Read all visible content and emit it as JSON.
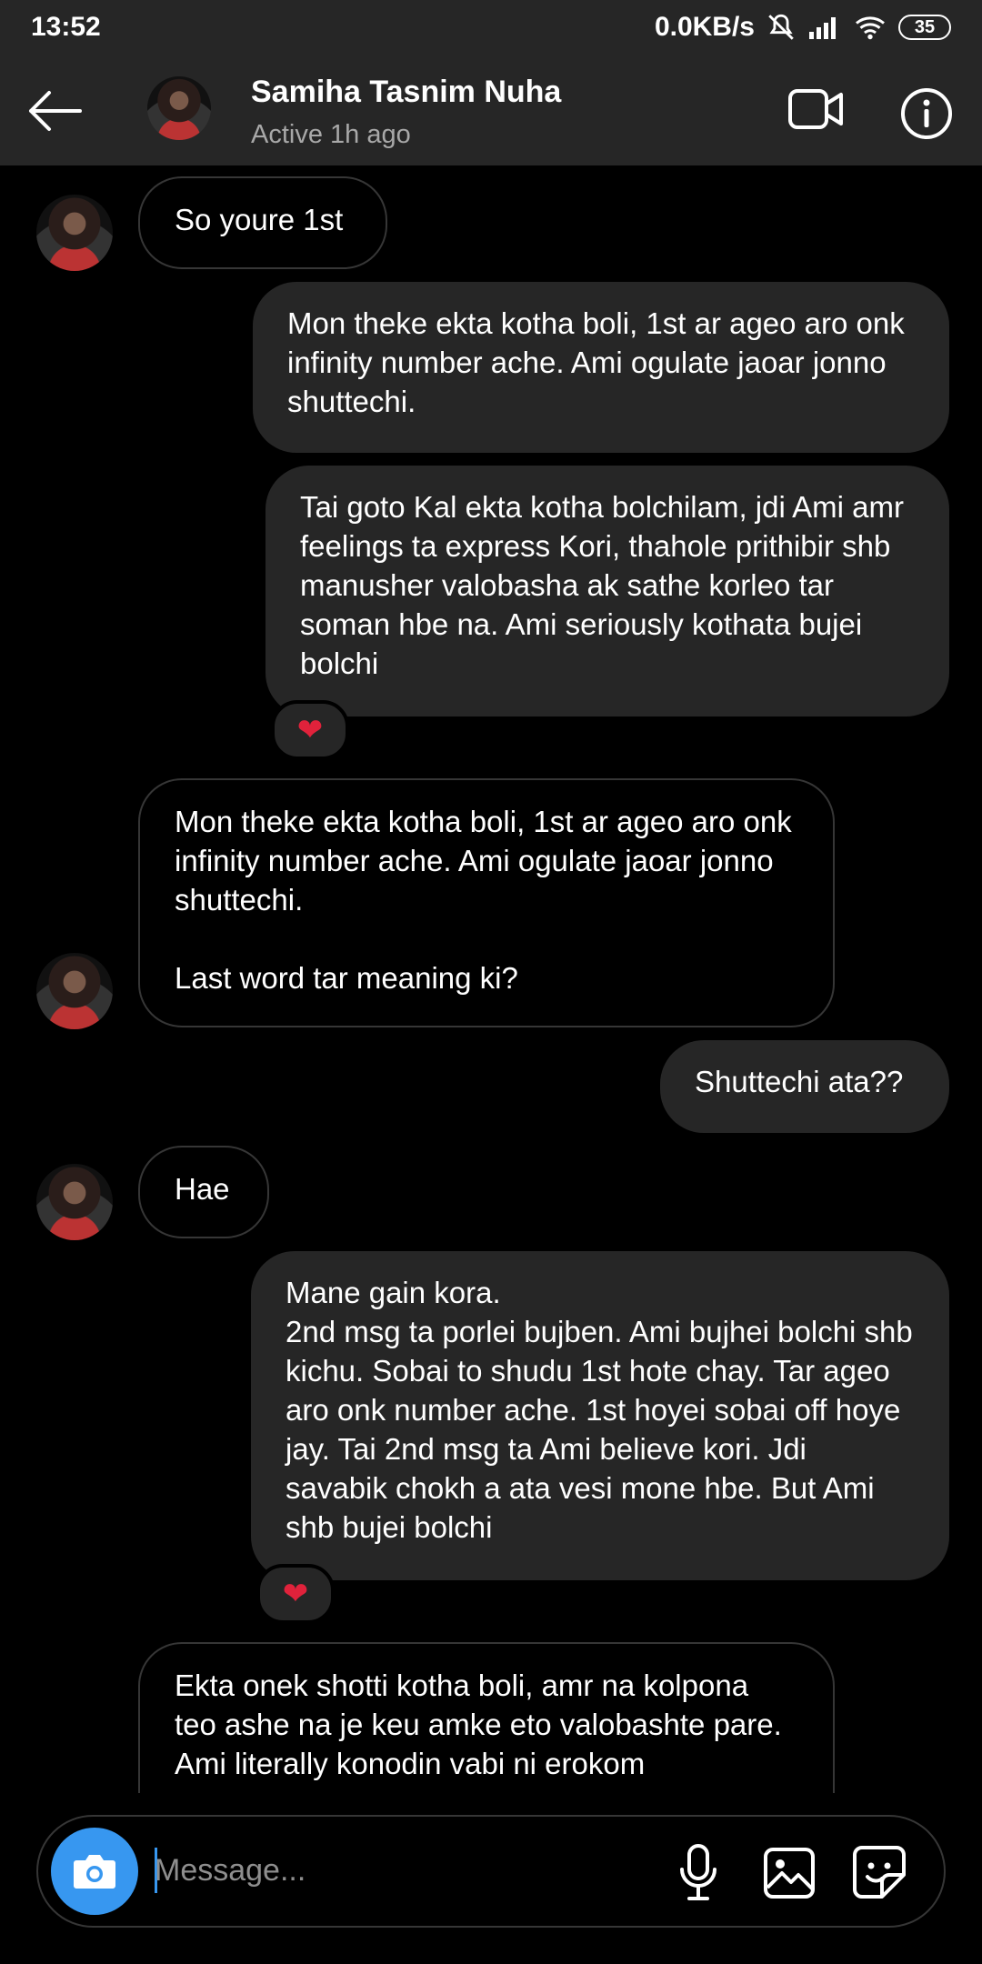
{
  "statusbar": {
    "time": "13:52",
    "network_speed": "0.0KB/s",
    "battery": "35"
  },
  "header": {
    "name": "Samiha Tasnim Nuha",
    "status": "Active 1h ago"
  },
  "messages": [
    {
      "side": "in",
      "text": "So youre 1st"
    },
    {
      "side": "out",
      "text": "Mon theke ekta kotha boli, 1st ar ageo aro onk infinity number ache. Ami ogulate jaoar jonno shuttechi."
    },
    {
      "side": "out",
      "text": "Tai goto Kal ekta kotha bolchilam, jdi Ami amr feelings ta express Kori, thahole prithibir shb manusher valobasha ak sathe korleo tar soman hbe na. Ami seriously kothata bujei bolchi",
      "reaction": "❤"
    },
    {
      "side": "in",
      "text": "Mon theke ekta kotha boli, 1st ar ageo aro onk infinity number ache. Ami ogulate jaoar jonno shuttechi.\n\nLast word tar meaning ki?"
    },
    {
      "side": "out",
      "text": "Shuttechi ata??"
    },
    {
      "side": "in",
      "text": "Hae"
    },
    {
      "side": "out",
      "text": "Mane gain kora.\n2nd msg ta porlei bujben. Ami bujhei bolchi shb kichu. Sobai to shudu 1st hote chay. Tar ageo aro onk number ache. 1st hoyei sobai off hoye jay. Tai 2nd msg ta Ami believe kori. Jdi savabik chokh a ata vesi mone hbe. But Ami shb bujei bolchi",
      "reaction": "❤"
    },
    {
      "side": "in",
      "text": "Ekta onek shotti kotha boli, amr na kolpona teo ashe na je keu amke eto valobashte pare. Ami literally konodin vabi ni erokom"
    }
  ],
  "composer": {
    "placeholder": "Message..."
  },
  "colors": {
    "accent": "#3797f0",
    "reaction": "#e0223b",
    "bubble_out": "#262626"
  }
}
